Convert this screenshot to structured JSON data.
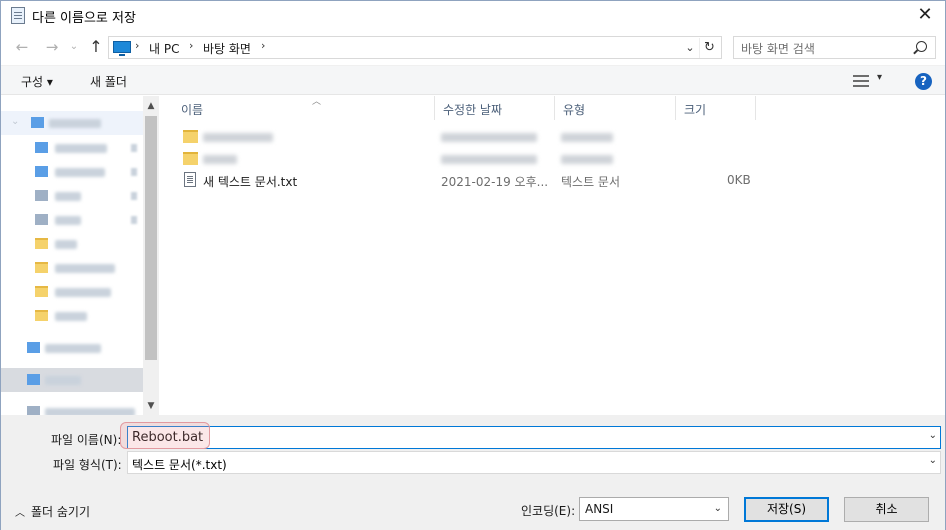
{
  "window": {
    "title": "다른 이름으로 저장",
    "close_label": "✕"
  },
  "nav": {
    "back": "←",
    "forward": "→",
    "up": "↑",
    "breadcrumbs": [
      "내 PC",
      "바탕 화면"
    ],
    "search_placeholder": "바탕 화면 검색"
  },
  "toolbar": {
    "organize": "구성 ▾",
    "new_folder": "새 폴더",
    "view_drop": "▾",
    "help": "?"
  },
  "filelist": {
    "columns": [
      "이름",
      "수정한 날짜",
      "유형",
      "크기"
    ],
    "files": [
      {
        "name": "새 텍스트 문서.txt",
        "modified": "2021-02-19 오후...",
        "type": "텍스트 문서",
        "size": "0KB"
      }
    ]
  },
  "form": {
    "filename_label": "파일 이름(N):",
    "filename_value": "Reboot.bat",
    "filetype_label": "파일 형식(T):",
    "filetype_value": "텍스트 문서(*.txt)",
    "encoding_label": "인코딩(E):",
    "encoding_value": "ANSI",
    "hide_folders": "폴더 숨기기",
    "save": "저장(S)",
    "cancel": "취소"
  }
}
